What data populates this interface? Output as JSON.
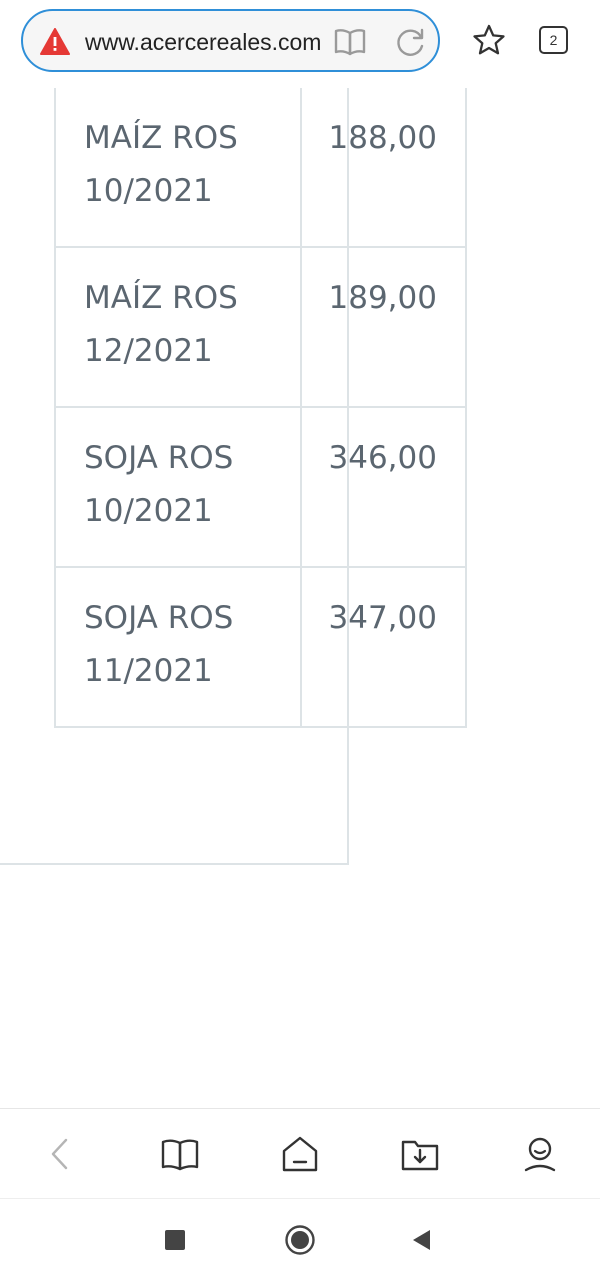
{
  "browser": {
    "url": "www.acercereales.com.ar",
    "tab_count": "2",
    "icons": {
      "security": "warning-icon",
      "reader": "reader-mode-icon",
      "reload": "reload-icon",
      "bookmark": "star-icon",
      "tabs": "tabs-icon"
    }
  },
  "price_table": {
    "rows": [
      {
        "line1": "MAÍZ ROS",
        "line2": "10/2021",
        "price": "188,00"
      },
      {
        "line1": "MAÍZ ROS",
        "line2": "12/2021",
        "price": "189,00"
      },
      {
        "line1": "SOJA ROS",
        "line2": "10/2021",
        "price": "346,00"
      },
      {
        "line1": "SOJA ROS",
        "line2": "11/2021",
        "price": "347,00"
      }
    ]
  },
  "toolbar": {
    "items": [
      "back-icon",
      "bookmarks-icon",
      "home-icon",
      "downloads-icon",
      "profile-icon"
    ]
  },
  "system_nav": {
    "items": [
      "recents-icon",
      "home-icon",
      "back-icon"
    ]
  },
  "colors": {
    "accent": "#2f8fd8",
    "warning": "#e53935",
    "table_border": "#dde3e6",
    "table_text": "#5b6670",
    "icon": "#333333"
  }
}
